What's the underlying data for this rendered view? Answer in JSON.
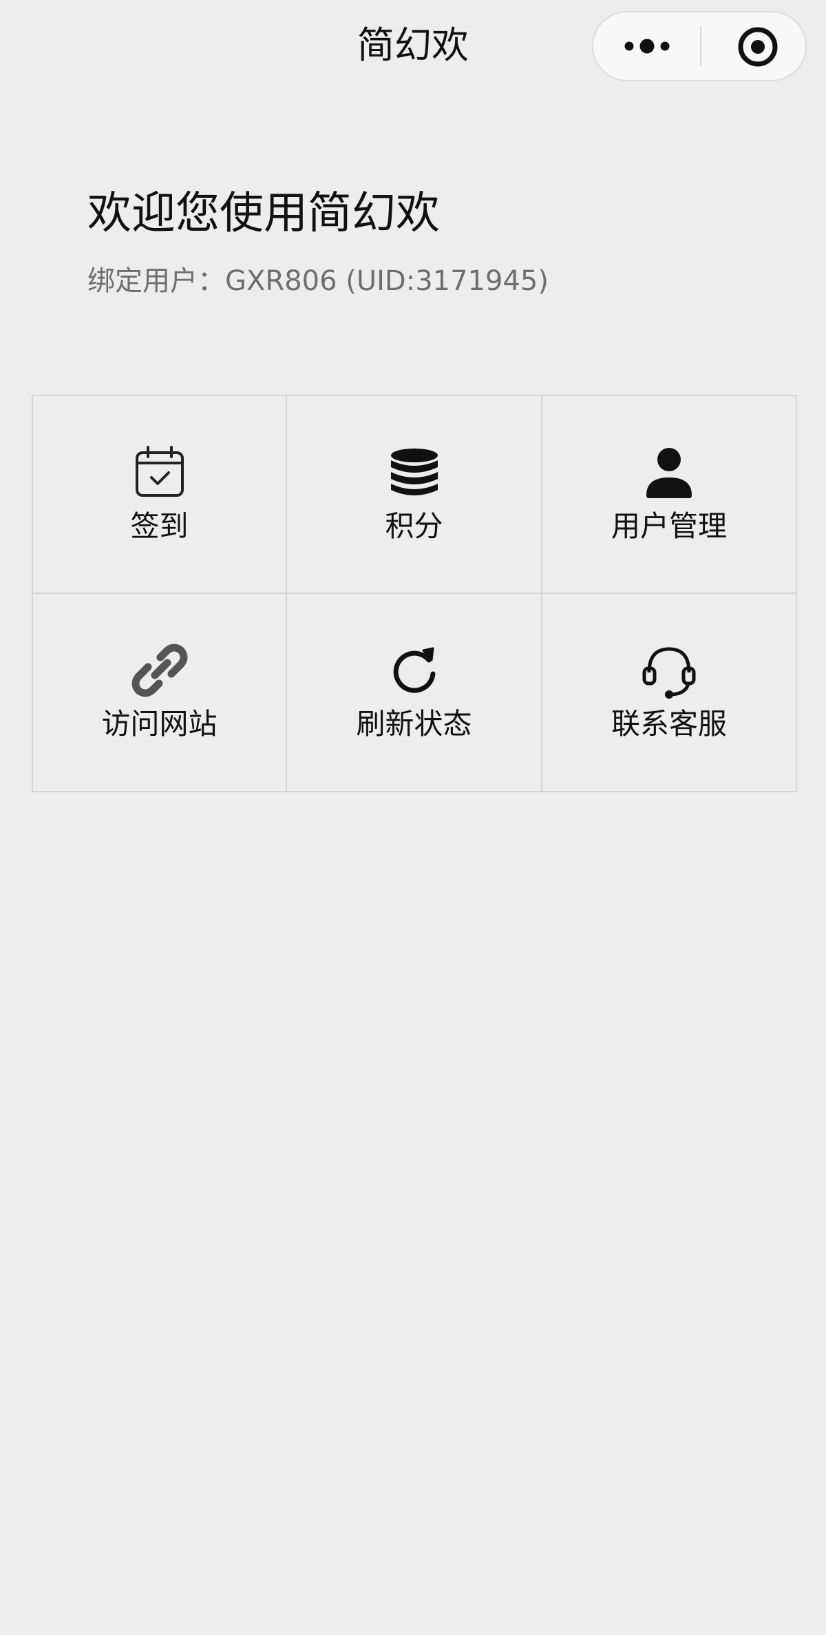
{
  "navbar": {
    "title": "简幻欢",
    "more_icon": "more-dots-icon",
    "close_icon": "target-close-icon"
  },
  "welcome": {
    "title": "欢迎您使用简幻欢",
    "bound_user": "绑定用户：GXR806 (UID:3171945)"
  },
  "menu": {
    "items": [
      {
        "label": "签到",
        "icon": "calendar-check-icon"
      },
      {
        "label": "积分",
        "icon": "coin-stack-icon"
      },
      {
        "label": "用户管理",
        "icon": "user-icon"
      },
      {
        "label": "访问网站",
        "icon": "link-icon"
      },
      {
        "label": "刷新状态",
        "icon": "refresh-icon"
      },
      {
        "label": "联系客服",
        "icon": "headset-icon"
      }
    ]
  },
  "colors": {
    "background": "#ededed",
    "text": "#111111",
    "secondary_text": "#6e6e6e",
    "grid_line": "#d4d4d4",
    "link_icon": "#555555"
  }
}
